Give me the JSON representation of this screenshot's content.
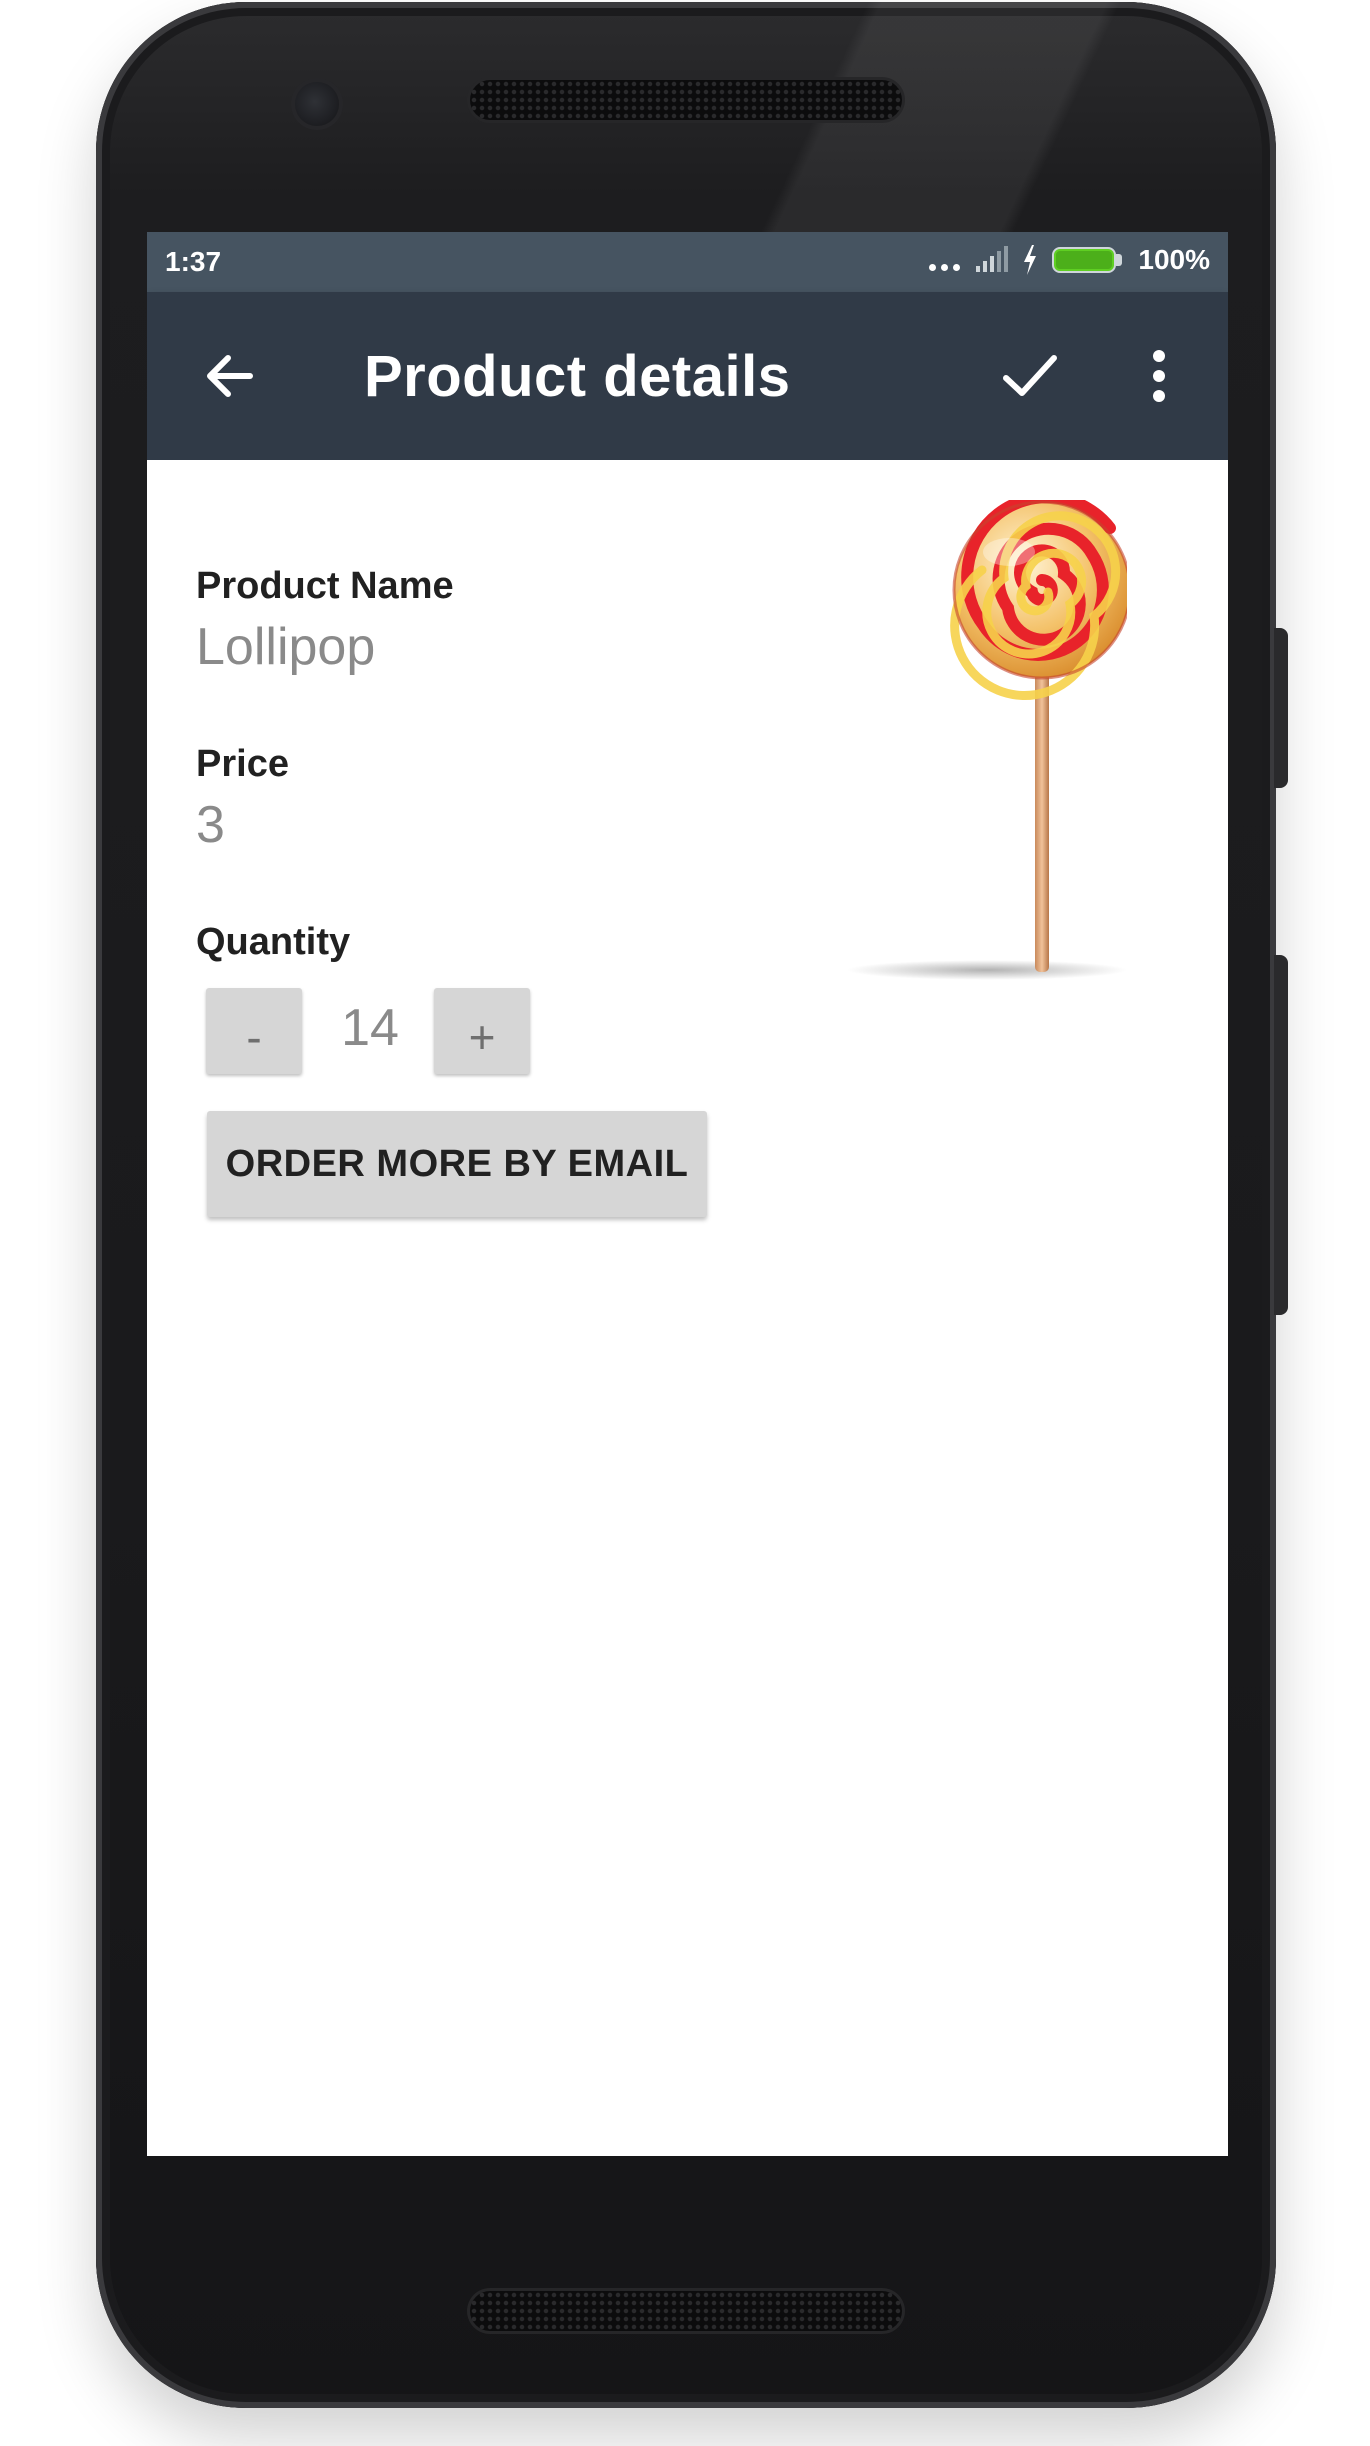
{
  "status_bar": {
    "time": "1:37",
    "battery_percent": "100%",
    "battery_level": 1.0,
    "icons": [
      "more-dots-icon",
      "signal-icon",
      "charging-icon",
      "battery-icon"
    ],
    "battery_color": "#4caf1a"
  },
  "app_bar": {
    "title": "Product details",
    "background_color": "#303a47",
    "icons": [
      "back-arrow-icon",
      "checkmark-icon",
      "overflow-menu-icon"
    ]
  },
  "product": {
    "name_label": "Product Name",
    "name_value": "Lollipop",
    "price_label": "Price",
    "price_value": "3",
    "quantity_label": "Quantity",
    "quantity_value": "14",
    "decrement_label": "-",
    "increment_label": "+",
    "image_icon": "lollipop-image"
  },
  "actions": {
    "order_button_label": "ORDER MORE BY EMAIL"
  }
}
